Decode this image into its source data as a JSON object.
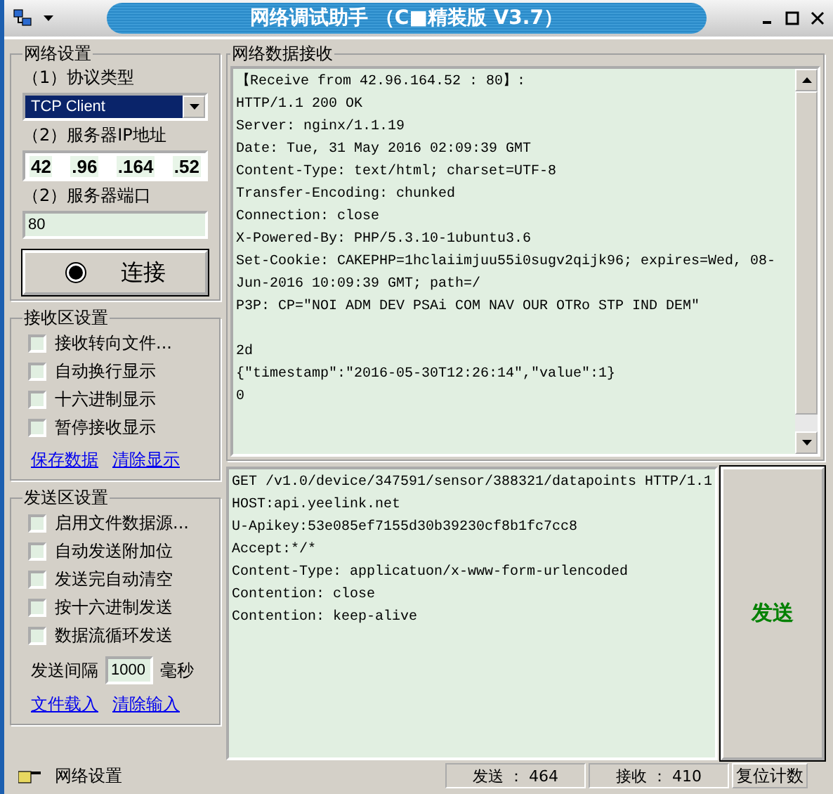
{
  "window": {
    "title": "网络调试助手 （C■精装版 V3.7）"
  },
  "network_settings": {
    "title": "网络设置",
    "protocol_label": "（1）协议类型",
    "protocol_value": "TCP Client",
    "ip_label": "（2）服务器IP地址",
    "ip_octets": [
      "42",
      ".96",
      ".164",
      ".52"
    ],
    "port_label": "（2）服务器端口",
    "port_value": "80",
    "connect_button": "连接"
  },
  "receive_settings": {
    "title": "接收区设置",
    "options": [
      {
        "label": "接收转向文件...",
        "checked": false
      },
      {
        "label": "自动换行显示",
        "checked": false
      },
      {
        "label": "十六进制显示",
        "checked": false
      },
      {
        "label": "暂停接收显示",
        "checked": false
      }
    ],
    "links": [
      "保存数据",
      "清除显示"
    ]
  },
  "send_settings": {
    "title": "发送区设置",
    "options": [
      {
        "label": "启用文件数据源...",
        "checked": false
      },
      {
        "label": "自动发送附加位",
        "checked": false
      },
      {
        "label": "发送完自动清空",
        "checked": false
      },
      {
        "label": "按十六进制发送",
        "checked": false
      },
      {
        "label": "数据流循环发送",
        "checked": false
      }
    ],
    "interval_label": "发送间隔",
    "interval_value": "1000",
    "interval_unit": "毫秒",
    "links": [
      "文件载入",
      "清除输入"
    ]
  },
  "receive_panel": {
    "title": "网络数据接收",
    "header_lines": [
      "【Receive from 42.96.164.52 : 80】:",
      "HTTP/1.1 200 OK",
      "Server: nginx/1.1.19",
      "Date: Tue, 31 May 2016 02:09:39 GMT",
      "Content-Type: text/html; charset=UTF-8",
      "Transfer-Encoding: chunked",
      "Connection: close",
      "X-Powered-By: PHP/5.3.10-1ubuntu3.6",
      "Set-Cookie: CAKEPHP=1hclaiimjuu55i0sugv2qijk96; expires=Wed, 08-",
      "Jun-2016 10:09:39 GMT; path=/",
      "P3P: CP=\"NOI ADM DEV PSAi COM NAV OUR OTRo STP IND DEM\""
    ],
    "body_lines": [
      "2d",
      "{\"timestamp\":\"2016-05-30T12:26:14\",\"value\":1}",
      "0"
    ]
  },
  "send_panel": {
    "lines": [
      "GET /v1.0/device/347591/sensor/388321/datapoints HTTP/1.1",
      "HOST:api.yeelink.net",
      "U-Apikey:53e085ef7155d30b39230cf8b1fc7cc8",
      "Accept:*/*",
      "Content-Type: applicatuon/x-www-form-urlencoded",
      "Contention: close",
      "Contention: keep-alive"
    ],
    "send_button": "发送"
  },
  "status_bar": {
    "text": "网络设置",
    "sent": "发送 ： 464",
    "received": "接收 ： 410",
    "reset_button": "复位计数"
  }
}
